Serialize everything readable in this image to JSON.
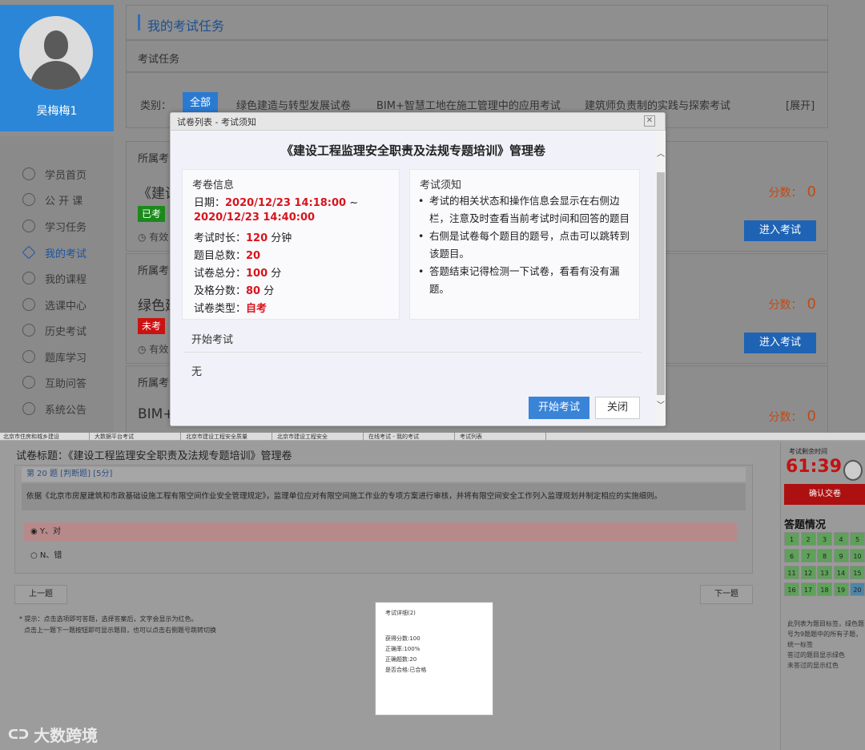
{
  "profile": {
    "username": "吴梅梅1"
  },
  "sidebar": {
    "items": [
      {
        "label": "学员首页",
        "active": false
      },
      {
        "label": "公 开 课",
        "active": false
      },
      {
        "label": "学习任务",
        "active": false
      },
      {
        "label": "我的考试",
        "active": true
      },
      {
        "label": "我的课程",
        "active": false
      },
      {
        "label": "选课中心",
        "active": false
      },
      {
        "label": "历史考试",
        "active": false
      },
      {
        "label": "题库学习",
        "active": false
      },
      {
        "label": "互助问答",
        "active": false
      },
      {
        "label": "系统公告",
        "active": false
      }
    ]
  },
  "page": {
    "title": "我的考试任务",
    "section": "考试任务"
  },
  "filter": {
    "label": "类别：",
    "all": "全部",
    "categories": [
      "绿色建造与转型发展试卷",
      "BIM+智慧工地在施工管理中的应用考试",
      "建筑师负责制的实践与探索考试"
    ],
    "expand": "[展开]"
  },
  "exams": [
    {
      "header": "所属考",
      "name": "《建设",
      "badge": "已考",
      "badge_color": "#1a8a1a",
      "valid": "有效",
      "score_label": "分数：",
      "score": "0",
      "enter": "进入考试"
    },
    {
      "header": "所属考",
      "name": "绿色建",
      "badge": "未考",
      "badge_color": "#cc1111",
      "valid": "有效",
      "score_label": "分数：",
      "score": "0",
      "enter": "进入考试"
    },
    {
      "header": "所属考",
      "name": "BIM+",
      "score_label": "分数：",
      "score": "0"
    }
  ],
  "modal": {
    "window_title": "试卷列表 - 考试须知",
    "close": "✕",
    "heading": "《建设工程监理安全职责及法规专题培训》管理卷",
    "info_title": "考卷信息",
    "date_label": "日期：",
    "date_start": "2020/12/23 14:18:00",
    "date_sep": " ~",
    "date_end": "2020/12/23 14:40:00",
    "duration_label": "考试时长：",
    "duration_value": "120",
    "duration_unit": " 分钟",
    "count_label": "题目总数：",
    "count_value": "20",
    "total_label": "试卷总分：",
    "total_value": "100",
    "total_unit": " 分",
    "pass_label": "及格分数：",
    "pass_value": "80",
    "pass_unit": " 分",
    "type_label": "试卷类型：",
    "type_value": "自考",
    "notice_title": "考试须知",
    "notices": [
      "考试的相关状态和操作信息会显示在右侧边栏，注意及时查看当前考试时间和回答的题目",
      "右侧是试卷每个题目的题号，点击可以跳转到该题目。",
      "答题结束记得检测一下试卷，看看有没有漏题。"
    ],
    "start_section": "开始考试",
    "none": "无",
    "start_button": "开始考试",
    "close_button": "关闭"
  },
  "exam_page": {
    "title": "试卷标题：《建设工程监理安全职责及法规专题培训》管理卷",
    "question_head": "第 20 题 [判断题] [5分]",
    "question_text": "依据《北京市房屋建筑和市政基础设施工程有限空间作业安全管理规定》，监理单位应对有限空间施工作业的专项方案进行审核，并将有限空间安全工作列入监理规划并制定相应的实施细则。",
    "option_y": "Y、对",
    "option_n": "N、错",
    "prev": "上一题",
    "next": "下一题",
    "tips": [
      "* 提示：点击选项即可答题，选择答案后，文字会显示为红色。",
      "点击上一题下一题按钮即可显示题目，也可以点击右侧题号跳转切换"
    ]
  },
  "result": {
    "title": "考试详细(2)",
    "lines": [
      "获得分数:100",
      "正确率:100%",
      "正确题数:20",
      "是否合格:已合格"
    ]
  },
  "side_panel": {
    "time_label": "考试剩余时间",
    "timer": "61:39",
    "submit": "确认交卷",
    "answer_title": "答题情况",
    "numbers": [
      "1",
      "2",
      "3",
      "4",
      "5",
      "6",
      "7",
      "8",
      "9",
      "10",
      "11",
      "12",
      "13",
      "14",
      "15",
      "16",
      "17",
      "18",
      "19",
      "20"
    ],
    "legend": [
      "此列表为题目标签，绿色题号为9题题中的所有子题，统一标签",
      "答过的题目显示绿色",
      "未答过的显示红色"
    ]
  },
  "browser_tabs": [
    "北京市住房和城乡建设",
    "大数据平台考试",
    "北京市建设工程安全质量",
    "北京市建设工程安全",
    "在线考试 - 我的考试",
    "考试列表"
  ],
  "watermark": "大数跨境"
}
